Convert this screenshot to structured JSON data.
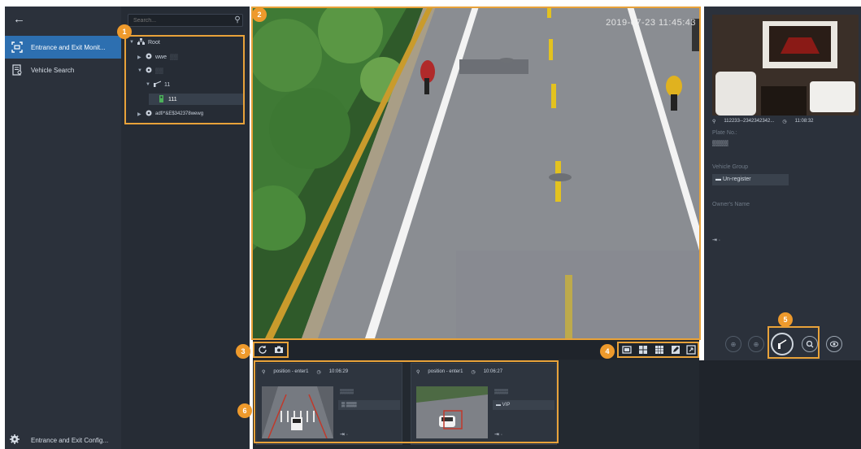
{
  "nav": {
    "back_icon": "arrow-left-icon",
    "items": [
      {
        "label": "Entrance and Exit Monit...",
        "icon": "monitor-scan-icon",
        "active": true
      },
      {
        "label": "Vehicle Search",
        "icon": "document-search-icon",
        "active": false
      }
    ],
    "config_label": "Entrance and Exit Config..."
  },
  "tree": {
    "search_placeholder": "Search...",
    "root": "Root",
    "nodes": [
      "wwe",
      "11",
      "111",
      "adf/*&E$342378wewg"
    ]
  },
  "video": {
    "timestamp": "2019-07-23 11:45:43"
  },
  "toolbar": {
    "left_icons": [
      "refresh-icon",
      "snapshot-icon"
    ],
    "layout_icons": [
      "single-window-icon",
      "four-window-icon",
      "nine-window-icon",
      "edit-layout-icon",
      "fullscreen-icon"
    ]
  },
  "records": [
    {
      "position": "position - enter1",
      "time": "10:06:29",
      "exit_icon": "exit-icon"
    },
    {
      "position": "position - enter1",
      "time": "10:06:27",
      "group": "VIP",
      "exit_icon": "exit-icon"
    }
  ],
  "info": {
    "channel": "112233--2342342342...",
    "time": "11:08:32",
    "plate_label": "Plate No.:",
    "group_label": "Vehicle Group",
    "group_value": "Un-register",
    "owner_label": "Owner's Name"
  },
  "callouts": [
    "1",
    "2",
    "3",
    "4",
    "5",
    "6"
  ],
  "colors": {
    "accent": "#2d6fb0",
    "callout": "#ee9a2c",
    "panel": "#2b313b"
  }
}
